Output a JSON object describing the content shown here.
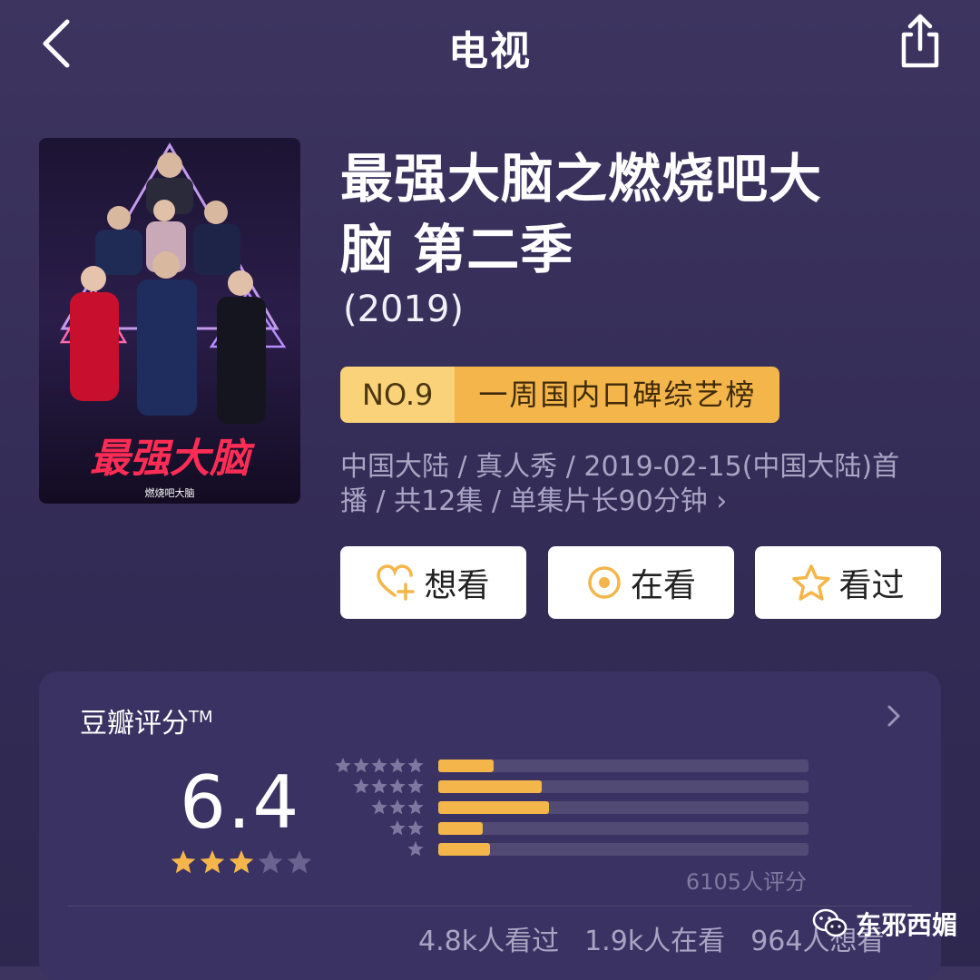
{
  "header": {
    "title": "电视",
    "back_icon": "back-chevron-icon",
    "share_icon": "share-icon"
  },
  "show": {
    "title_line1": "最强大脑之燃烧吧大",
    "title_line2": "脑 第二季",
    "year": "(2019)",
    "poster_text": "最强大脑",
    "poster_subtext": "燃烧吧大脑"
  },
  "rank": {
    "number": "NO.9",
    "label": "一周国内口碑综艺榜"
  },
  "meta": {
    "line1": "中国大陆 / 真人秀 / 2019-02-15(中国大陆)首",
    "line2": "播 / 共12集 / 单集片长90分钟",
    "chevron": "›"
  },
  "actions": [
    {
      "label": "想看",
      "icon": "heart-plus-icon"
    },
    {
      "label": "在看",
      "icon": "target-circle-icon"
    },
    {
      "label": "看过",
      "icon": "star-outline-icon"
    }
  ],
  "rating": {
    "label": "豆瓣评分",
    "tm": "TM",
    "score": "6.4",
    "stars_filled": 3,
    "stars_total": 5,
    "distribution": [
      {
        "stars": 5,
        "fraction": 0.15
      },
      {
        "stars": 4,
        "fraction": 0.28
      },
      {
        "stars": 3,
        "fraction": 0.3
      },
      {
        "stars": 2,
        "fraction": 0.12
      },
      {
        "stars": 1,
        "fraction": 0.14
      }
    ],
    "count": "6105人评分",
    "watched": "4.8k人看过",
    "watching": "1.9k人在看",
    "want": "964人想看"
  },
  "watermark": {
    "text": "东邪西媚",
    "icon": "wechat-icon"
  },
  "colors": {
    "accent": "#f4b64a",
    "badge_light": "#f9d27a",
    "background": "#3d3560",
    "card": "#3a3262"
  }
}
